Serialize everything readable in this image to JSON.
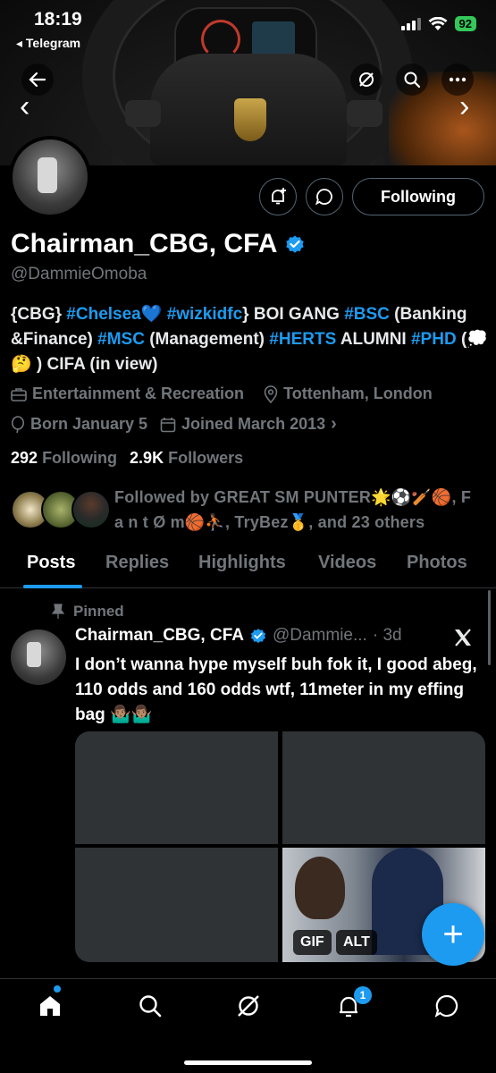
{
  "status_bar": {
    "time": "18:19",
    "back_app": "◂ Telegram",
    "battery": "92"
  },
  "profile": {
    "name": "Chairman_CBG, CFA",
    "handle": "@DammieOmoba",
    "following_button": "Following",
    "bio_parts": [
      {
        "text": "{CBG} ",
        "tag": false
      },
      {
        "text": "#Chelsea",
        "tag": true
      },
      {
        "text": "💙 ",
        "tag": false
      },
      {
        "text": "#wizkidfc",
        "tag": true
      },
      {
        "text": "} BOI GANG ",
        "tag": false
      },
      {
        "text": "#BSC",
        "tag": true
      },
      {
        "text": " (Banking &Finance) ",
        "tag": false
      },
      {
        "text": "#MSC",
        "tag": true
      },
      {
        "text": " (Management) ",
        "tag": false
      },
      {
        "text": "#HERTS",
        "tag": true
      },
      {
        "text": " ALUMNI ",
        "tag": false
      },
      {
        "text": "#PHD",
        "tag": true
      },
      {
        "text": " (💭 🤔 ) CIFA (in view)",
        "tag": false
      }
    ],
    "category": "Entertainment & Recreation",
    "location": "Tottenham, London",
    "born": "Born January 5",
    "joined": "Joined March 2013",
    "following_count": "292",
    "following_label": "Following",
    "followers_count": "2.9K",
    "followers_label": "Followers",
    "followed_by": "Followed by GREAT SM PUNTER🌟⚽🏏🏀, F a n t Ø m🏀⛹🏾, TryBez🥇, and 23 others"
  },
  "tabs": [
    "Posts",
    "Replies",
    "Highlights",
    "Videos",
    "Photos"
  ],
  "post": {
    "pinned_label": "Pinned",
    "author": "Chairman_CBG, CFA",
    "handle": "@Dammie...",
    "time": "· 3d",
    "text": "I don’t wanna hype myself buh fok it, I good abeg, 110 odds and 160 odds wtf, 11meter in my effing bag 🤷🏽‍♂️🤷🏽‍♂️",
    "badges": {
      "gif": "GIF",
      "alt": "ALT"
    }
  },
  "fab_label": "+",
  "notifications_count": "1",
  "colors": {
    "accent": "#1d9bf0",
    "muted": "#71767b",
    "background": "#000000"
  }
}
